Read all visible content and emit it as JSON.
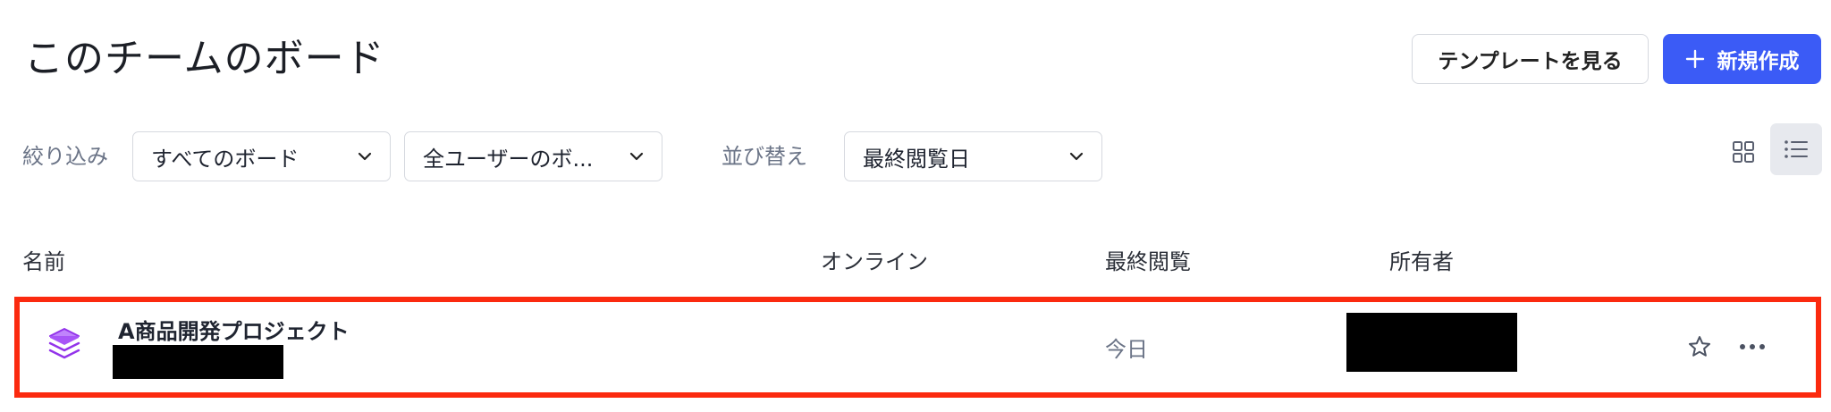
{
  "header": {
    "title": "このチームのボード",
    "template_button_label": "テンプレートを見る",
    "new_button_label": "新規作成",
    "new_button_color": "#3b5bf6"
  },
  "filters": {
    "filter_label": "絞り込み",
    "board_scope": "すべてのボード",
    "user_scope": "全ユーザーのボ...",
    "sort_label": "並び替え",
    "sort_value": "最終閲覧日"
  },
  "view_toggle": {
    "options": [
      "grid-view-icon",
      "list-view-icon"
    ],
    "selected": "list-view-icon"
  },
  "table": {
    "columns": {
      "name": "名前",
      "online": "オンライン",
      "last_viewed": "最終閲覧",
      "owner": "所有者"
    },
    "rows": [
      {
        "icon": "board-stack-icon",
        "icon_color": "#a855f7",
        "name": "A商品開発プロジェクト",
        "last_viewed": "今日",
        "highlight_color": "#fb2a0f"
      }
    ]
  }
}
